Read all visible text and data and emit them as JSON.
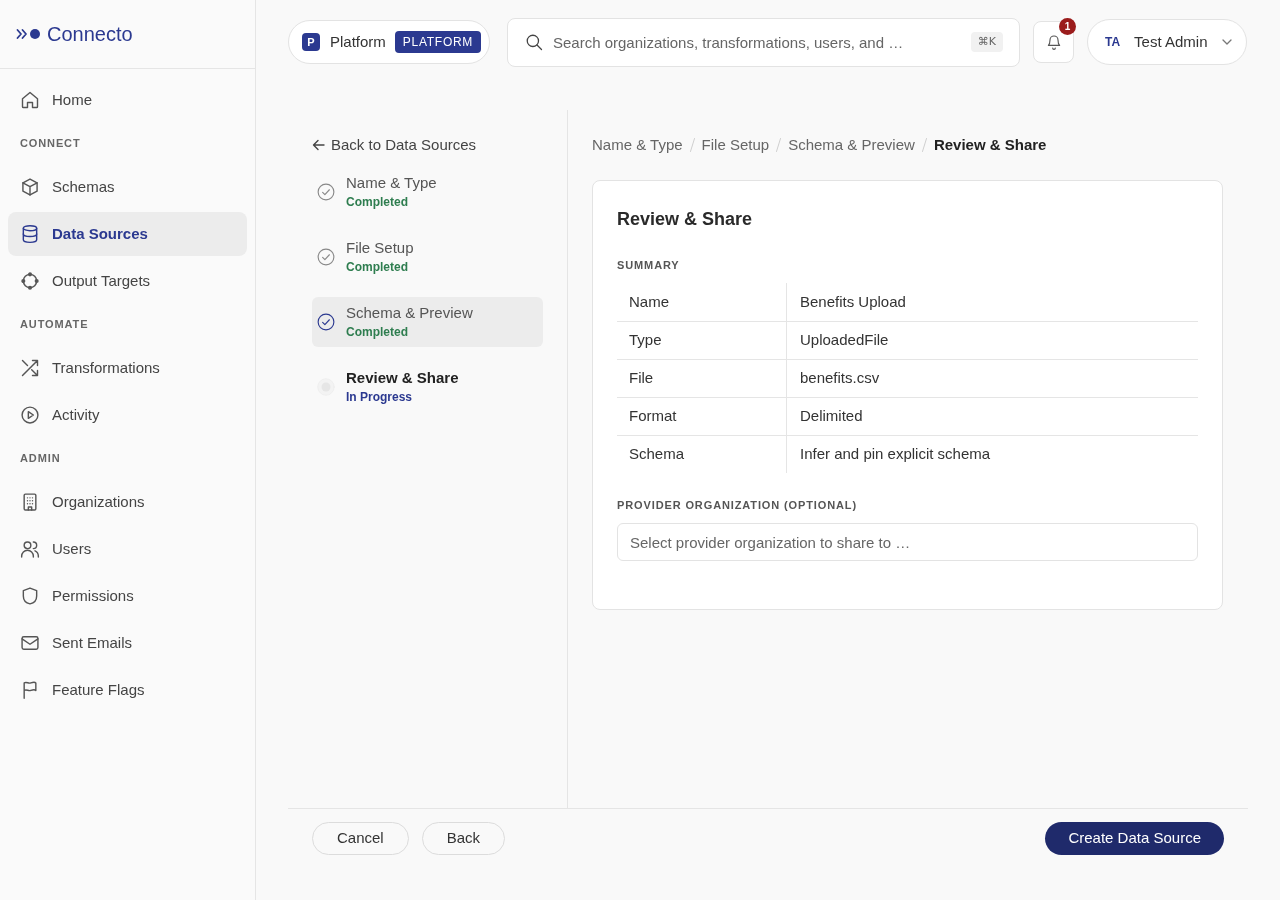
{
  "sidebar": {
    "logo": "Connecto",
    "sections": [
      {
        "items": [
          {
            "label": "Home",
            "selected": false
          }
        ]
      },
      {
        "heading": "CONNECT",
        "items": [
          {
            "label": "Schemas",
            "selected": false
          },
          {
            "label": "Data Sources",
            "selected": true
          },
          {
            "label": "Output Targets",
            "selected": false
          }
        ]
      },
      {
        "heading": "AUTOMATE",
        "items": [
          {
            "label": "Transformations",
            "selected": false
          },
          {
            "label": "Activity",
            "selected": false
          }
        ]
      },
      {
        "heading": "ADMIN",
        "items": [
          {
            "label": "Organizations",
            "selected": false
          },
          {
            "label": "Users",
            "selected": false
          },
          {
            "label": "Permissions",
            "selected": false
          },
          {
            "label": "Sent Emails",
            "selected": false
          },
          {
            "label": "Feature Flags",
            "selected": false
          }
        ]
      }
    ]
  },
  "header": {
    "workspace": {
      "initial": "P",
      "name": "Platform",
      "badge": "PLATFORM"
    },
    "search": {
      "placeholder": "Search organizations, transformations, users, and …",
      "shortcut": "⌘K"
    },
    "notifications": {
      "count": "1"
    },
    "user": {
      "initials": "TA",
      "name": "Test Admin"
    }
  },
  "wizard": {
    "back_link": "Back to Data Sources",
    "steps": [
      {
        "title": "Name & Type",
        "status": "Completed",
        "kind": "completed",
        "selected": false
      },
      {
        "title": "File Setup",
        "status": "Completed",
        "kind": "completed",
        "selected": false
      },
      {
        "title": "Schema & Preview",
        "status": "Completed",
        "kind": "completed",
        "selected": true
      },
      {
        "title": "Review & Share",
        "status": "In Progress",
        "kind": "in_progress",
        "selected": false
      }
    ]
  },
  "breadcrumb": [
    {
      "label": "Name & Type",
      "current": false
    },
    {
      "label": "File Setup",
      "current": false
    },
    {
      "label": "Schema & Preview",
      "current": false
    },
    {
      "label": "Review & Share",
      "current": true
    }
  ],
  "card": {
    "title": "Review & Share",
    "summary_heading": "SUMMARY",
    "summary": [
      {
        "label": "Name",
        "value": "Benefits Upload"
      },
      {
        "label": "Type",
        "value": "UploadedFile"
      },
      {
        "label": "File",
        "value": "benefits.csv"
      },
      {
        "label": "Format",
        "value": "Delimited"
      },
      {
        "label": "Schema",
        "value": "Infer and pin explicit schema"
      }
    ],
    "provider": {
      "label": "PROVIDER ORGANIZATION (OPTIONAL)",
      "placeholder": "Select provider organization to share to …"
    }
  },
  "footer": {
    "buttons": [
      {
        "label": "Cancel",
        "kind": "secondary"
      },
      {
        "label": "Back",
        "kind": "secondary"
      },
      {
        "label": "Create Data Source",
        "kind": "primary"
      }
    ]
  }
}
